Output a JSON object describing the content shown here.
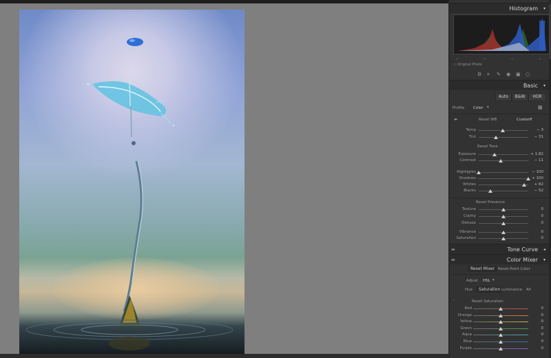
{
  "panel": {
    "histogram_title": "Histogram",
    "original_photo": "Original Photo",
    "basic_title": "Basic",
    "auto": "Auto",
    "bw": "B&W",
    "hdr": "HDR",
    "profile_label": "Profile",
    "profile_value": "Color",
    "reset_wb": "Reset WB",
    "wb_value": "Custom",
    "reset_tone": "Reset Tone",
    "reset_presence": "Reset Presence",
    "tone_curve_title": "Tone Curve",
    "color_mixer_title": "Color Mixer",
    "reset_mixer": "Reset Mixer",
    "reset_point_color": "Reset Point Color",
    "adjust_label": "Adjust",
    "adjust_value": "HSL",
    "hsl_tabs": [
      "Hue",
      "Saturation",
      "Luminance",
      "All"
    ],
    "reset_saturation": "Reset Saturation",
    "wb_sliders": [
      {
        "label": "Temp",
        "value": "− 3",
        "level": 0.48
      },
      {
        "label": "Tint",
        "value": "− 31",
        "level": 0.35
      }
    ],
    "tone_sliders": [
      {
        "label": "Exposure",
        "value": "+ 1.82",
        "level": 0.32
      },
      {
        "label": "Contrast",
        "value": "− 11",
        "level": 0.44
      }
    ],
    "tone_sliders_2": [
      {
        "label": "Highlights",
        "value": "− 100",
        "level": 0.0
      },
      {
        "label": "Shadows",
        "value": "+ 100",
        "level": 1.0
      },
      {
        "label": "Whites",
        "value": "+ 82",
        "level": 0.91
      },
      {
        "label": "Blacks",
        "value": "− 52",
        "level": 0.24
      }
    ],
    "presence_sliders": [
      {
        "label": "Texture",
        "value": "0",
        "level": 0.5
      },
      {
        "label": "Clarity",
        "value": "0",
        "level": 0.5
      },
      {
        "label": "Dehaze",
        "value": "0",
        "level": 0.5
      }
    ],
    "presence_sliders_2": [
      {
        "label": "Vibrance",
        "value": "0",
        "level": 0.5
      },
      {
        "label": "Saturation",
        "value": "0",
        "level": 0.5
      }
    ],
    "saturation_sliders": [
      {
        "label": "Red",
        "value": "0",
        "level": 0.5,
        "color": "#c0504d"
      },
      {
        "label": "Orange",
        "value": "0",
        "level": 0.5,
        "color": "#d08040"
      },
      {
        "label": "Yellow",
        "value": "0",
        "level": 0.5,
        "color": "#c8b840"
      },
      {
        "label": "Green",
        "value": "0",
        "level": 0.5,
        "color": "#4f9a4a"
      },
      {
        "label": "Aqua",
        "value": "0",
        "level": 0.5,
        "color": "#4aa8a8"
      },
      {
        "label": "Blue",
        "value": "0",
        "level": 0.5,
        "color": "#4a6ac8"
      },
      {
        "label": "Purple",
        "value": "0",
        "level": 0.5,
        "color": "#8a5ac0"
      }
    ]
  }
}
